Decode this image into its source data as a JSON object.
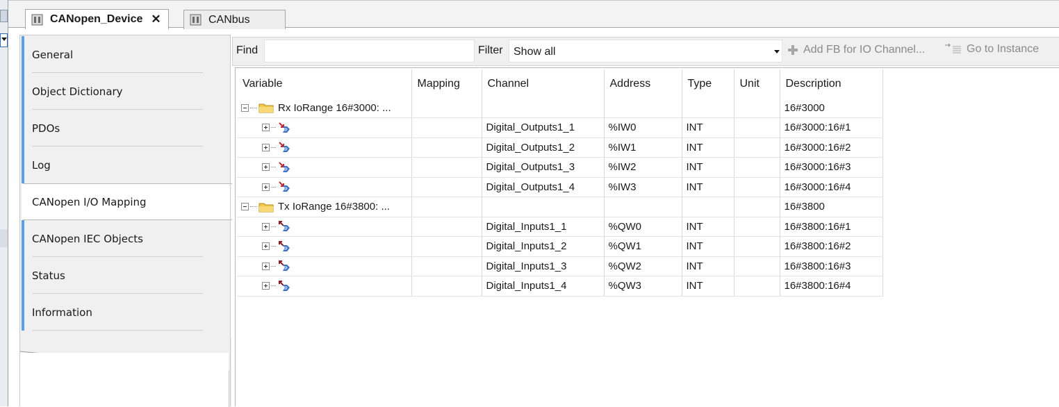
{
  "tabs": [
    {
      "label": "CANopen_Device",
      "active": true,
      "closable": true,
      "icon": "device-icon"
    },
    {
      "label": "CANbus",
      "active": false,
      "closable": false,
      "icon": "device-icon"
    }
  ],
  "tab_close_glyph": "✕",
  "nav": {
    "items": [
      {
        "label": "General"
      },
      {
        "label": "Object Dictionary"
      },
      {
        "label": "PDOs"
      },
      {
        "label": "Log"
      },
      {
        "label": "CANopen I/O Mapping"
      },
      {
        "label": "CANopen IEC Objects"
      },
      {
        "label": "Status"
      },
      {
        "label": "Information"
      }
    ],
    "active_index": 4
  },
  "toolbar": {
    "find_label": "Find",
    "find_value": "",
    "filter_label": "Filter",
    "filter_value": "Show all",
    "add_fb_label": "Add FB for IO Channel...",
    "goto_label": "Go to Instance"
  },
  "table": {
    "columns": [
      "Variable",
      "Mapping",
      "Channel",
      "Address",
      "Type",
      "Unit",
      "Description"
    ],
    "groups": [
      {
        "label": "Rx IoRange 16#3000: ...",
        "description": "16#3000",
        "rows": [
          {
            "channel": "Digital_Outputs1_1",
            "address": "%IW0",
            "type": "INT",
            "unit": "",
            "description": "16#3000:16#1"
          },
          {
            "channel": "Digital_Outputs1_2",
            "address": "%IW1",
            "type": "INT",
            "unit": "",
            "description": "16#3000:16#2"
          },
          {
            "channel": "Digital_Outputs1_3",
            "address": "%IW2",
            "type": "INT",
            "unit": "",
            "description": "16#3000:16#3"
          },
          {
            "channel": "Digital_Outputs1_4",
            "address": "%IW3",
            "type": "INT",
            "unit": "",
            "description": "16#3000:16#4"
          }
        ]
      },
      {
        "label": "Tx IoRange 16#3800: ...",
        "description": "16#3800",
        "rows": [
          {
            "channel": "Digital_Inputs1_1",
            "address": "%QW0",
            "type": "INT",
            "unit": "",
            "description": "16#3800:16#1"
          },
          {
            "channel": "Digital_Inputs1_2",
            "address": "%QW1",
            "type": "INT",
            "unit": "",
            "description": "16#3800:16#2"
          },
          {
            "channel": "Digital_Inputs1_3",
            "address": "%QW2",
            "type": "INT",
            "unit": "",
            "description": "16#3800:16#3"
          },
          {
            "channel": "Digital_Inputs1_4",
            "address": "%QW3",
            "type": "INT",
            "unit": "",
            "description": "16#3800:16#4"
          }
        ]
      }
    ]
  },
  "colors": {
    "accent": "#5aa0e8",
    "folder": "#f2c94c",
    "channel_arrow": "#c0282d",
    "channel_body": "#3f6fbf"
  }
}
